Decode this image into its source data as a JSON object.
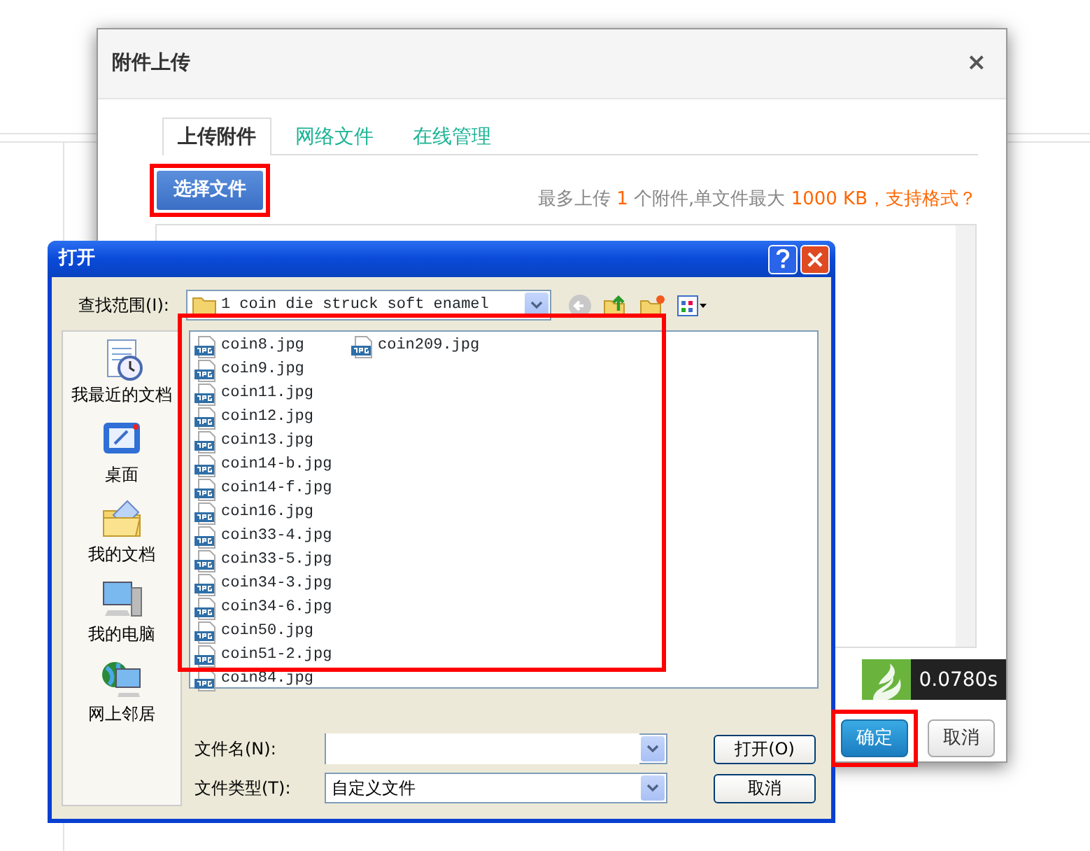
{
  "modal": {
    "title": "附件上传",
    "close": "×",
    "tabs": [
      {
        "label": "上传附件",
        "selected": true
      },
      {
        "label": "网络文件",
        "selected": false
      },
      {
        "label": "在线管理",
        "selected": false
      }
    ],
    "choose_button": {
      "label": "选择文件",
      "highlighted": true
    },
    "limit_text": [
      {
        "text": "最多上传 ",
        "kind": "plain"
      },
      {
        "text": "1",
        "kind": "accent"
      },
      {
        "text": " 个附件,单文件最大 ",
        "kind": "plain"
      },
      {
        "text": "1000 KB",
        "kind": "accent"
      },
      {
        "text": "，",
        "kind": "accent"
      },
      {
        "text": "支持格式？",
        "kind": "link"
      }
    ],
    "timer": "0.0780s",
    "buttons": [
      {
        "label": "确定",
        "kind": "primary",
        "highlighted": true
      },
      {
        "label": "取消",
        "kind": "default",
        "highlighted": false
      }
    ]
  },
  "open_dialog": {
    "title": "打开",
    "look_in_label": "查找范围(I):",
    "look_in": "1 coin die struck soft enamel",
    "places": [
      {
        "label": "我最近的文档",
        "kind": "recent"
      },
      {
        "label": "桌面",
        "kind": "desktop"
      },
      {
        "label": "我的文档",
        "kind": "documents"
      },
      {
        "label": "我的电脑",
        "kind": "computer"
      },
      {
        "label": "网上邻居",
        "kind": "network"
      }
    ],
    "files": [
      "coin8.jpg",
      "coin9.jpg",
      "coin11.jpg",
      "coin12.jpg",
      "coin13.jpg",
      "coin14-b.jpg",
      "coin14-f.jpg",
      "coin16.jpg",
      "coin33-4.jpg",
      "coin33-5.jpg",
      "coin34-3.jpg",
      "coin34-6.jpg",
      "coin50.jpg",
      "coin51-2.jpg",
      "coin84.jpg",
      "coin209.jpg"
    ],
    "file_list_highlighted": true,
    "filename_label": "文件名(N):",
    "filetype_label": "文件类型(T):",
    "filetype": "自定义文件",
    "buttons": [
      "打开(O)",
      "取消"
    ]
  }
}
